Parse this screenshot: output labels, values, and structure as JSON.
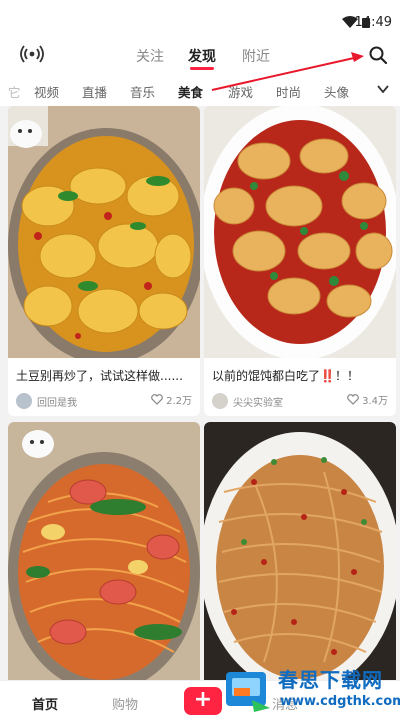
{
  "status_bar": {
    "time": "14:49"
  },
  "top_nav": {
    "tabs": [
      {
        "label": "关注"
      },
      {
        "label": "发现"
      },
      {
        "label": "附近"
      }
    ]
  },
  "categories": [
    "视频",
    "直播",
    "音乐",
    "美食",
    "游戏",
    "时尚",
    "头像"
  ],
  "feed": {
    "cards": [
      {
        "title": "土豆别再炒了，试试这样做......",
        "author": "回回是我",
        "likes": "2.2万"
      },
      {
        "title": "以前的馄饨都白吃了‼️！！",
        "author": "尖尖实验室",
        "likes": "3.4万"
      },
      {
        "title": "",
        "author": "",
        "likes": ""
      },
      {
        "title": "",
        "author": "",
        "likes": ""
      }
    ]
  },
  "bottom_nav": {
    "home": "首页",
    "shop": "购物",
    "plus": "+",
    "messages": "消息"
  },
  "watermark": {
    "title": "春思下载网",
    "url": "www.cdgthk.com"
  },
  "colors": {
    "accent": "#ff2442",
    "annotation_arrow": "#e8192c"
  }
}
